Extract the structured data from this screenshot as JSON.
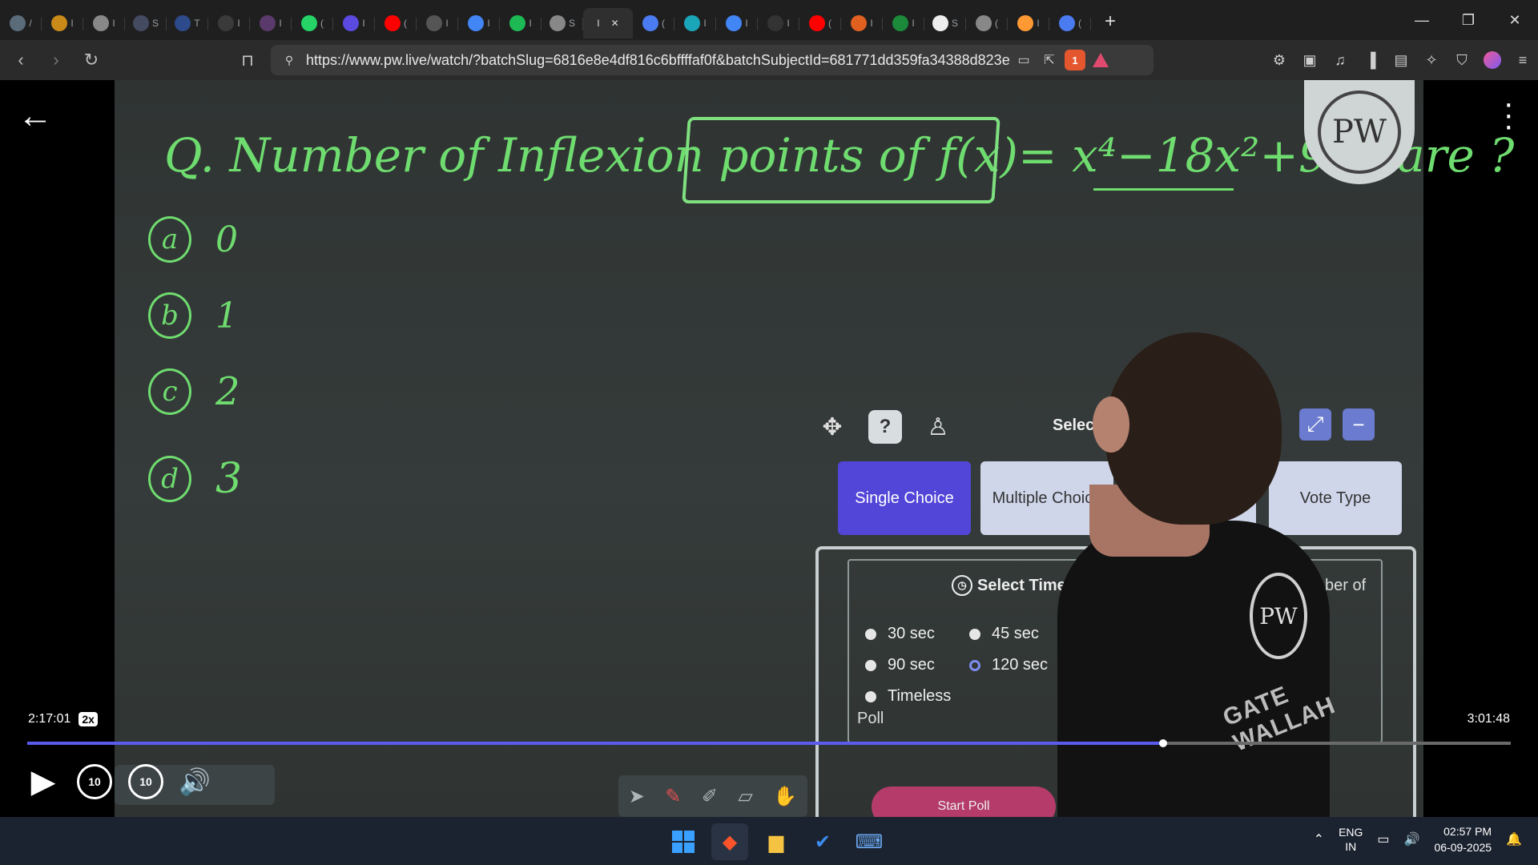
{
  "browser": {
    "tabs": [
      {
        "icon": "edge-icon",
        "label": "/",
        "color": "#5a6b7a"
      },
      {
        "icon": "bitcoin-icon",
        "label": "I",
        "color": "#c98a1a"
      },
      {
        "icon": "globe-icon",
        "label": "I",
        "color": "#888888"
      },
      {
        "icon": "avatar-icon",
        "label": "S",
        "color": "#444a60"
      },
      {
        "icon": "w3-icon",
        "label": "T",
        "color": "#2d4a8a"
      },
      {
        "icon": "mail-icon",
        "label": "I",
        "color": "#3a3a3a"
      },
      {
        "icon": "avatar-icon",
        "label": "I",
        "color": "#5a3a6a"
      },
      {
        "icon": "whatsapp-icon",
        "label": "(",
        "color": "#25d366"
      },
      {
        "icon": "bookmark-icon",
        "label": "I",
        "color": "#5b4ae0"
      },
      {
        "icon": "youtube-icon",
        "label": "(",
        "color": "#ff0000"
      },
      {
        "icon": "orbit-icon",
        "label": "I",
        "color": "#555555"
      },
      {
        "icon": "google-icon",
        "label": "I",
        "color": "#4285f4"
      },
      {
        "icon": "spotify-icon",
        "label": "I",
        "color": "#1db954"
      },
      {
        "icon": "globe-icon",
        "label": "S",
        "color": "#888888"
      }
    ],
    "active_tab": {
      "label": "I",
      "close": "✕"
    },
    "tabs_after": [
      {
        "icon": "gemini-icon",
        "label": "(",
        "color": "#4a7bf0"
      },
      {
        "icon": "pw-icon",
        "label": "I",
        "color": "#1aa6b8"
      },
      {
        "icon": "google-icon",
        "label": "I",
        "color": "#4285f4"
      },
      {
        "icon": "monitor-icon",
        "label": "I",
        "color": "#333333"
      },
      {
        "icon": "youtube-icon",
        "label": "(",
        "color": "#ff0000"
      },
      {
        "icon": "flag-icon",
        "label": "I",
        "color": "#e06020"
      },
      {
        "icon": "check-icon",
        "label": "I",
        "color": "#1b8a3a"
      },
      {
        "icon": "wikipedia-icon",
        "label": "S",
        "color": "#eeeeee"
      },
      {
        "icon": "globe-icon",
        "label": "(",
        "color": "#888888"
      },
      {
        "icon": "india-flag-icon",
        "label": "I",
        "color": "#ff9933"
      },
      {
        "icon": "gemini-icon",
        "label": "(",
        "color": "#4a7bf0"
      }
    ],
    "new_tab": "+",
    "url": "https://www.pw.live/watch/?batchSlug=6816e8e4df816c6bffffaf0f&batchSubjectId=681771dd359fa34388d823e...",
    "brave_badge": "1"
  },
  "board": {
    "question": "Q. Number of Inflexion points of f(x)= x⁴−18x²+9 is/are ?",
    "options": [
      {
        "letter": "a",
        "value": "0"
      },
      {
        "letter": "b",
        "value": "1"
      },
      {
        "letter": "c",
        "value": "2"
      },
      {
        "letter": "d",
        "value": "3"
      }
    ],
    "logo_text": "PW"
  },
  "poll": {
    "select_label": "Select F",
    "choices": [
      "Single Choice",
      "Multiple Choice",
      "",
      "Vote Type"
    ],
    "selected_choice": "Single Choice",
    "timer_title": "Select Timer",
    "timers": [
      "30 sec",
      "45 sec",
      "90 sec",
      "120 sec",
      "Timeless"
    ],
    "selected_timer": "120 sec",
    "poll_word": "Poll",
    "number_of": "ber of",
    "start_poll": "Start Poll",
    "shirt_text": "GATE WALLAH"
  },
  "player": {
    "current_time": "2:17:01",
    "speed": "2x",
    "total_time": "3:01:48",
    "progress": 0.7658,
    "skip_back": "10",
    "skip_forward": "10"
  },
  "taskbar": {
    "lang_top": "ENG",
    "lang_bottom": "IN",
    "time": "02:57 PM",
    "date": "06-09-2025"
  }
}
